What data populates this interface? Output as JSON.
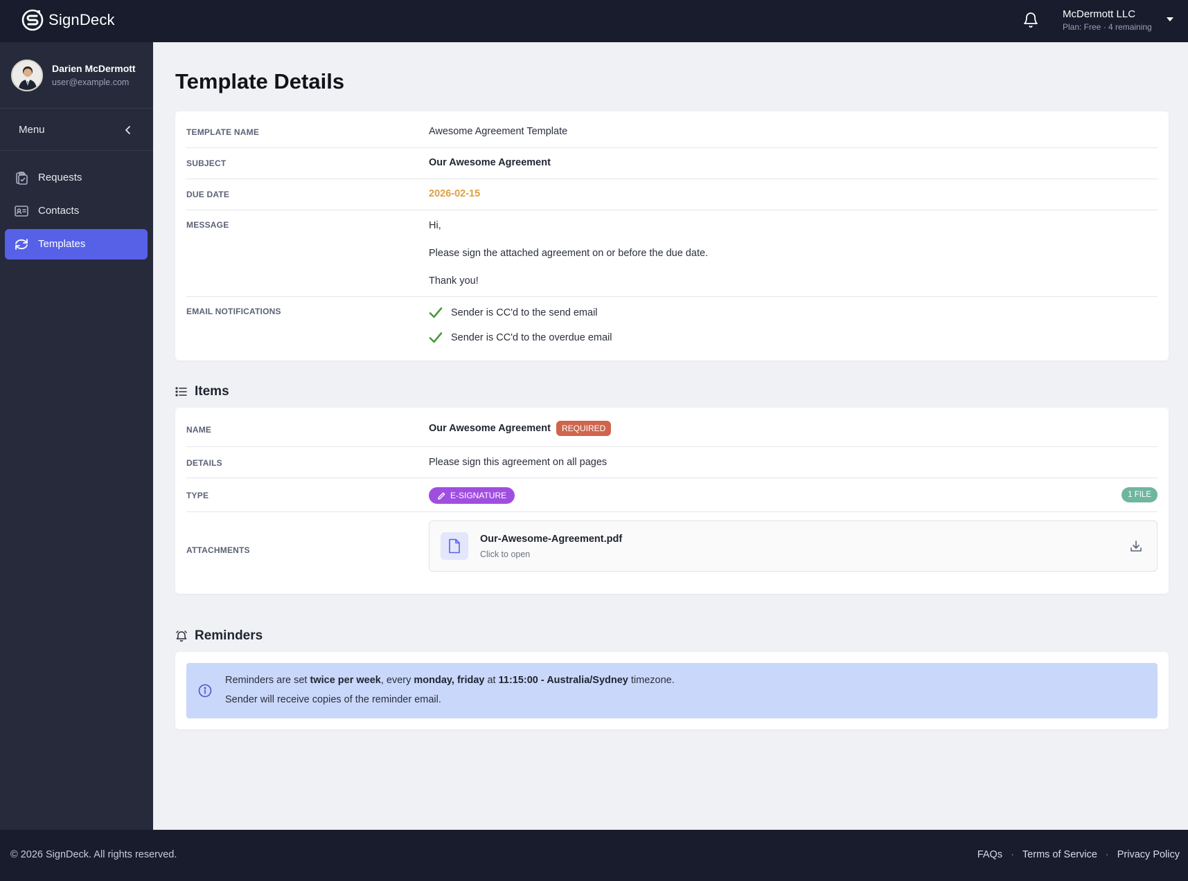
{
  "app": {
    "brand": "SignDeck"
  },
  "topbar": {
    "account_name": "McDermott LLC",
    "account_plan": "Plan: Free · 4 remaining"
  },
  "sidebar": {
    "user_name": "Darien McDermott",
    "user_email": "user@example.com",
    "menu_label": "Menu",
    "items": [
      {
        "label": "Requests",
        "icon": "clipboard-check-icon",
        "active": false
      },
      {
        "label": "Contacts",
        "icon": "contact-card-icon",
        "active": false
      },
      {
        "label": "Templates",
        "icon": "refresh-icon",
        "active": true
      }
    ]
  },
  "page": {
    "title": "Template Details"
  },
  "details": {
    "template_name_label": "TEMPLATE NAME",
    "template_name": "Awesome Agreement Template",
    "subject_label": "SUBJECT",
    "subject": "Our Awesome Agreement",
    "due_date_label": "DUE DATE",
    "due_date": "2026-02-15",
    "message_label": "MESSAGE",
    "message_lines": [
      "Hi,",
      "Please sign the attached agreement on or before the due date.",
      "Thank you!"
    ],
    "notifications_label": "EMAIL NOTIFICATIONS",
    "notifications": [
      "Sender is CC'd to the send email",
      "Sender is CC'd to the overdue email"
    ]
  },
  "items": {
    "section_title": "Items",
    "name_label": "NAME",
    "name": "Our Awesome Agreement",
    "required_badge": "REQUIRED",
    "details_label": "DETAILS",
    "details": "Please sign this agreement on all pages",
    "type_label": "TYPE",
    "type": "E-SIGNATURE",
    "file_count": "1 FILE",
    "attachments_label": "ATTACHMENTS",
    "attachment_name": "Our-Awesome-Agreement.pdf",
    "attachment_hint": "Click to open"
  },
  "reminders": {
    "section_title": "Reminders",
    "text_1": "Reminders are set ",
    "frequency": "twice per week",
    "text_2": ", every ",
    "days": "monday, friday",
    "text_3": " at ",
    "time_zone": "11:15:00 - Australia/Sydney",
    "text_4": " timezone.",
    "line2": "Sender will receive copies of the reminder email."
  },
  "footer": {
    "copyright": "© 2026 SignDeck. All rights reserved.",
    "links": [
      "FAQs",
      "Terms of Service",
      "Privacy Policy"
    ],
    "separator": "·"
  },
  "colors": {
    "sidebar_bg": "#262a3a",
    "topbar_bg": "#181c2c",
    "accent": "#5661e8",
    "due_date": "#e0a040",
    "required": "#d0654e",
    "esignature": "#a04ee0",
    "file_badge": "#6fb5a0",
    "check": "#4a9a3c",
    "info_bg": "#c9d7fa"
  }
}
